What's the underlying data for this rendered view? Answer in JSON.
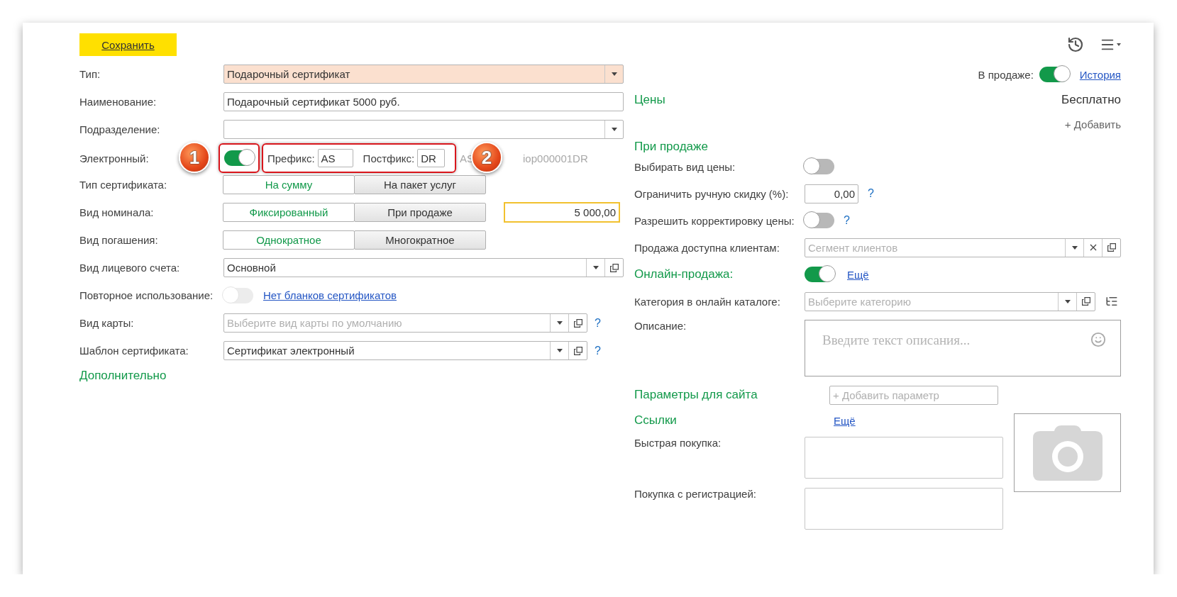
{
  "toolbar": {
    "save_button": "Сохранить"
  },
  "left_form": {
    "rows": [
      {
        "kind": "select",
        "label": "Тип:",
        "value": "Подарочный сертификат",
        "highlighted": true,
        "open_button": false
      },
      {
        "kind": "text",
        "label": "Наименование:",
        "value": "Подарочный сертификат 5000 руб.",
        "highlighted": false
      },
      {
        "kind": "select",
        "label": "Подразделение:",
        "highlighted": false,
        "open_button": false
      },
      {
        "kind": "electronic",
        "label": "Электронный:",
        "on": true,
        "prefix_label": "Префикс:",
        "prefix": "AS",
        "postfix_label": "Постфикс:",
        "postfix": "DR",
        "code_start": "AS",
        "code_end": "iop000001DR",
        "callouts": [
          "1",
          "2"
        ]
      },
      {
        "kind": "segmented",
        "label": "Тип сертификата:",
        "options": [
          {
            "label": "На сумму",
            "selected": true
          },
          {
            "label": "На пакет услуг",
            "selected": false
          }
        ]
      },
      {
        "kind": "segmented",
        "label": "Вид номинала:",
        "options": [
          {
            "label": "Фиксированный",
            "selected": true
          },
          {
            "label": "При продаже",
            "selected": false
          }
        ],
        "amount": "5 000,00"
      },
      {
        "kind": "segmented",
        "label": "Вид погашения:",
        "options": [
          {
            "label": "Однократное",
            "selected": true
          },
          {
            "label": "Многократное",
            "selected": false
          }
        ]
      },
      {
        "kind": "select",
        "label": "Вид лицевого счета:",
        "value": "Основной",
        "highlighted": false,
        "open_button": true
      },
      {
        "kind": "toggle_link",
        "label": "Повторное использование:",
        "on": false,
        "disabled": true,
        "link": "Нет бланков сертификатов"
      },
      {
        "kind": "select",
        "label": "Вид карты:",
        "placeholder": "Выберите вид карты по умолчанию",
        "highlighted": false,
        "open_button": true,
        "help": "?"
      },
      {
        "kind": "select",
        "label": "Шаблон сертификата:",
        "value": "Сертификат электронный",
        "highlighted": false,
        "open_button": true,
        "help": "?"
      }
    ],
    "more_section": "Дополнительно"
  },
  "header": {
    "on_sale_label": "В продаже:",
    "on_sale": true,
    "history_link": "История"
  },
  "prices": {
    "title": "Цены",
    "value": "Бесплатно",
    "add_link": "+ Добавить"
  },
  "on_sale_section": {
    "title": "При продаже",
    "rows": [
      {
        "kind": "toggle",
        "label": "Выбирать вид цены:",
        "on": false
      },
      {
        "kind": "number",
        "label": "Ограничить ручную скидку (%):",
        "value": "0,00",
        "help": "?"
      },
      {
        "kind": "toggle",
        "label": "Разрешить корректировку цены:",
        "on": false,
        "help": "?"
      },
      {
        "kind": "select",
        "label": "Продажа доступна клиентам:",
        "placeholder": "Сегмент клиентов"
      }
    ]
  },
  "online": {
    "title": "Онлайн-продажа:",
    "on": true,
    "more_link": "Ещё",
    "category_label": "Категория в онлайн каталоге:",
    "category_placeholder": "Выберите категорию",
    "description_label": "Описание:",
    "description_placeholder": "Введите текст описания..."
  },
  "site_params": {
    "title": "Параметры для сайта",
    "placeholder": "+ Добавить параметр"
  },
  "links": {
    "title": "Ссылки",
    "more_link": "Ещё",
    "fields": [
      {
        "label": "Быстрая покупка:"
      },
      {
        "label": "Покупка с регистрацией:"
      }
    ]
  }
}
